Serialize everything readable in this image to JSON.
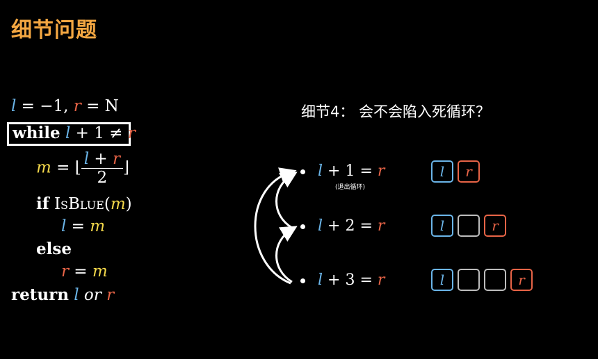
{
  "title": "细节问题",
  "heading": "细节4： 会不会陷入死循环？",
  "code": {
    "init_l": "l",
    "init_eq1": " = −1,",
    "init_r": "r",
    "init_eq2": " = N",
    "while_kw": "while",
    "while_l": "l",
    "while_cond": " + 1 ≠ ",
    "while_r": "r",
    "m_var": "m",
    "m_eq": " = ⌊",
    "frac_l": "l",
    "frac_plus": " + ",
    "frac_r": "r",
    "frac_den": "2",
    "floor_close": "⌋",
    "if_kw": "if",
    "isblue": "IsBlue",
    "isblue_paren_open": "(",
    "isblue_m": "m",
    "isblue_paren_close": ")",
    "assign_l": "l",
    "assign_l_eq": " = ",
    "assign_l_m": "m",
    "else_kw": "else",
    "assign_r": "r",
    "assign_r_eq": " = ",
    "assign_r_m": "m",
    "return_kw": "return",
    "return_l": "l",
    "return_or": " or ",
    "return_r": "r"
  },
  "cases": [
    {
      "l": "l",
      "op": " + 1 = ",
      "r": "r",
      "note": "(退出循环)",
      "cells": [
        "l",
        "r"
      ]
    },
    {
      "l": "l",
      "op": " + 2 = ",
      "r": "r",
      "cells": [
        "l",
        "",
        "r"
      ]
    },
    {
      "l": "l",
      "op": " + 3 = ",
      "r": "r",
      "cells": [
        "l",
        "",
        "",
        "r"
      ]
    }
  ]
}
